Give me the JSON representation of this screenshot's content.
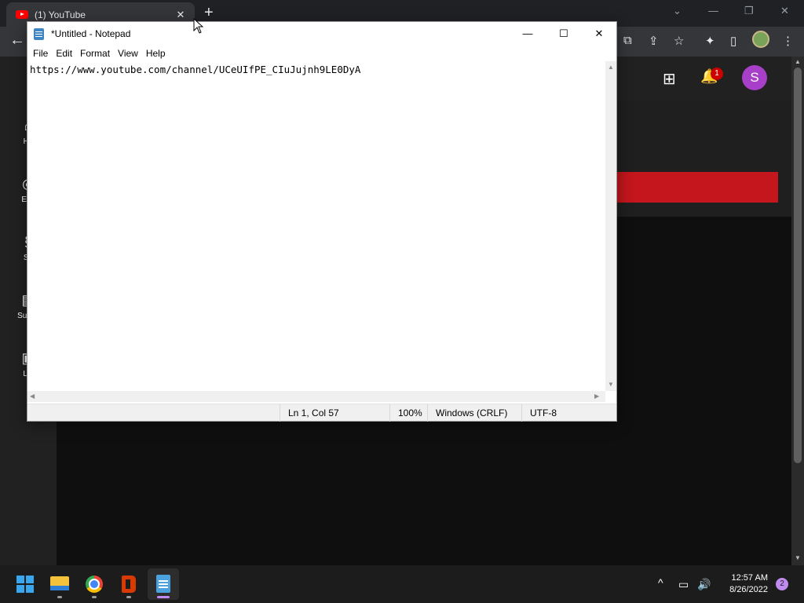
{
  "browser": {
    "tab": {
      "title": "(1) YouTube",
      "close": "✕"
    },
    "new_tab": "+",
    "window_controls": {
      "tab_search": "⌄",
      "minimize": "—",
      "restore": "❐",
      "close": "✕"
    },
    "toolbar": {
      "back": "←",
      "open_external": "⧉",
      "share": "⇪",
      "bookmark": "☆",
      "extensions": "✦",
      "side_panel": "▯",
      "menu": "⋮"
    }
  },
  "youtube": {
    "header": {
      "create": "⊞",
      "notifications": "🔔",
      "notification_count": "1",
      "avatar_letter": "S"
    },
    "sidebar": [
      {
        "icon": "⌂",
        "label": "Ho"
      },
      {
        "icon": "◎",
        "label": "Exp"
      },
      {
        "icon": "§",
        "label": "Sh"
      },
      {
        "icon": "▤",
        "label": "Subsc"
      },
      {
        "icon": "▣",
        "label": "Lib"
      }
    ],
    "colors": {
      "background": "#0f0f0f",
      "surface": "#212121",
      "accent_red": "#c4161c",
      "avatar": "#a83fc9"
    }
  },
  "notepad": {
    "title": "*Untitled - Notepad",
    "buttons": {
      "minimize": "—",
      "maximize": "☐",
      "close": "✕"
    },
    "menu": [
      "File",
      "Edit",
      "Format",
      "View",
      "Help"
    ],
    "content": "https://www.youtube.com/channel/UCeUIfPE_CIuJujnh9LE0DyA",
    "status": {
      "position": "Ln 1, Col 57",
      "zoom": "100%",
      "line_ending": "Windows (CRLF)",
      "encoding": "UTF-8"
    }
  },
  "taskbar": {
    "apps": [
      "start",
      "file-explorer",
      "chrome",
      "office",
      "notepad"
    ],
    "tray": {
      "chevron": "^",
      "network": "▭",
      "volume": "🔊"
    },
    "time": "12:57 AM",
    "date": "8/26/2022",
    "notification_count": "2"
  }
}
